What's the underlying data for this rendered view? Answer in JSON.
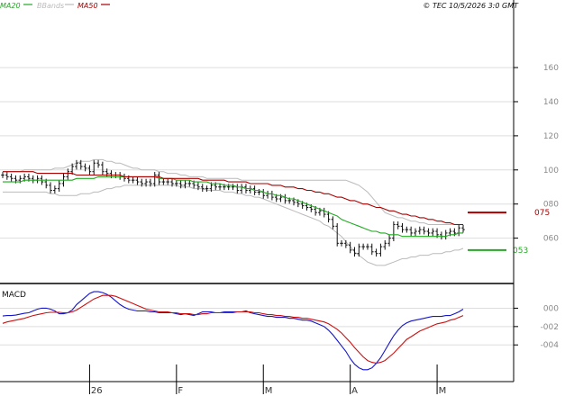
{
  "header": {
    "legend": [
      {
        "label": "MA20",
        "color": "#22aa22"
      },
      {
        "label": "BBands",
        "color": "#bbbbbb"
      },
      {
        "label": "MA50",
        "color": "#aa0000"
      }
    ],
    "copyright": "© TEC 10/5/2026 3:0 GMT"
  },
  "chart_data": [
    {
      "type": "candlestick",
      "panel": "price",
      "y_ticks": [
        "160",
        "140",
        "120",
        "100",
        "080",
        "060"
      ],
      "y_tick_values": [
        1.6,
        1.4,
        1.2,
        1.0,
        0.8,
        0.6
      ],
      "ylim": [
        0.35,
        1.88
      ],
      "x_ticks": [
        "26",
        "F",
        "M",
        "A",
        "M"
      ],
      "x_tick_index": [
        20,
        40,
        60,
        80,
        100
      ],
      "close": [
        0.97,
        0.96,
        0.95,
        0.94,
        0.95,
        0.96,
        0.95,
        0.94,
        0.95,
        0.93,
        0.91,
        0.88,
        0.89,
        0.92,
        0.96,
        0.99,
        1.02,
        1.04,
        1.02,
        1.01,
        0.99,
        1.04,
        1.03,
        0.99,
        0.98,
        0.97,
        0.97,
        0.96,
        0.95,
        0.94,
        0.94,
        0.93,
        0.92,
        0.93,
        0.92,
        0.97,
        0.93,
        0.93,
        0.93,
        0.92,
        0.92,
        0.91,
        0.92,
        0.92,
        0.91,
        0.9,
        0.89,
        0.89,
        0.91,
        0.9,
        0.9,
        0.9,
        0.9,
        0.9,
        0.88,
        0.9,
        0.88,
        0.89,
        0.87,
        0.87,
        0.85,
        0.86,
        0.84,
        0.83,
        0.84,
        0.82,
        0.82,
        0.81,
        0.8,
        0.79,
        0.78,
        0.77,
        0.75,
        0.76,
        0.74,
        0.71,
        0.67,
        0.57,
        0.57,
        0.56,
        0.53,
        0.51,
        0.55,
        0.55,
        0.55,
        0.52,
        0.51,
        0.55,
        0.57,
        0.6,
        0.68,
        0.67,
        0.65,
        0.65,
        0.63,
        0.64,
        0.65,
        0.64,
        0.63,
        0.64,
        0.62,
        0.61,
        0.63,
        0.64,
        0.63,
        0.66,
        0.65
      ],
      "overlays": [
        {
          "name": "MA20",
          "color": "#22aa22",
          "label": "053",
          "label_value": 0.53,
          "values": [
            0.93,
            0.93,
            0.93,
            0.93,
            0.93,
            0.94,
            0.94,
            0.94,
            0.94,
            0.94,
            0.94,
            0.94,
            0.94,
            0.94,
            0.94,
            0.94,
            0.94,
            0.95,
            0.95,
            0.95,
            0.95,
            0.95,
            0.96,
            0.96,
            0.96,
            0.96,
            0.96,
            0.96,
            0.96,
            0.96,
            0.96,
            0.96,
            0.96,
            0.96,
            0.96,
            0.96,
            0.95,
            0.95,
            0.95,
            0.95,
            0.94,
            0.94,
            0.94,
            0.94,
            0.93,
            0.93,
            0.93,
            0.93,
            0.92,
            0.92,
            0.92,
            0.91,
            0.91,
            0.91,
            0.9,
            0.9,
            0.89,
            0.89,
            0.88,
            0.88,
            0.87,
            0.86,
            0.86,
            0.85,
            0.85,
            0.84,
            0.83,
            0.83,
            0.82,
            0.81,
            0.8,
            0.79,
            0.78,
            0.77,
            0.76,
            0.75,
            0.74,
            0.73,
            0.71,
            0.7,
            0.69,
            0.68,
            0.67,
            0.66,
            0.65,
            0.64,
            0.64,
            0.63,
            0.63,
            0.62,
            0.62,
            0.62,
            0.61,
            0.61,
            0.61,
            0.61,
            0.61,
            0.61,
            0.61,
            0.61,
            0.61,
            0.61,
            0.61,
            0.62,
            0.62,
            0.63,
            0.63
          ]
        },
        {
          "name": "MA50",
          "color": "#aa0000",
          "label": "075",
          "label_value": 0.75,
          "values": [
            0.99,
            0.99,
            0.99,
            0.99,
            0.99,
            0.99,
            0.99,
            0.99,
            0.98,
            0.98,
            0.98,
            0.98,
            0.98,
            0.98,
            0.98,
            0.98,
            0.98,
            0.97,
            0.97,
            0.97,
            0.97,
            0.97,
            0.97,
            0.97,
            0.97,
            0.97,
            0.97,
            0.97,
            0.96,
            0.96,
            0.96,
            0.96,
            0.96,
            0.96,
            0.96,
            0.96,
            0.96,
            0.95,
            0.95,
            0.95,
            0.95,
            0.95,
            0.95,
            0.95,
            0.95,
            0.95,
            0.94,
            0.94,
            0.94,
            0.94,
            0.94,
            0.94,
            0.93,
            0.93,
            0.93,
            0.93,
            0.93,
            0.92,
            0.92,
            0.92,
            0.92,
            0.92,
            0.91,
            0.91,
            0.91,
            0.9,
            0.9,
            0.9,
            0.89,
            0.89,
            0.88,
            0.88,
            0.87,
            0.87,
            0.86,
            0.86,
            0.85,
            0.84,
            0.84,
            0.83,
            0.82,
            0.82,
            0.81,
            0.8,
            0.8,
            0.79,
            0.78,
            0.78,
            0.77,
            0.76,
            0.76,
            0.75,
            0.74,
            0.74,
            0.73,
            0.73,
            0.72,
            0.72,
            0.71,
            0.71,
            0.7,
            0.7,
            0.69,
            0.69,
            0.68,
            0.68,
            0.68
          ]
        },
        {
          "name": "BBands upper",
          "color": "#bbbbbb",
          "values": [
            0.99,
            0.99,
            0.99,
            0.99,
            0.99,
            1.0,
            1.0,
            1.0,
            1.0,
            1.0,
            1.0,
            1.0,
            1.01,
            1.01,
            1.01,
            1.02,
            1.03,
            1.04,
            1.05,
            1.05,
            1.05,
            1.06,
            1.06,
            1.06,
            1.05,
            1.05,
            1.04,
            1.04,
            1.03,
            1.02,
            1.01,
            1.01,
            1.0,
            1.0,
            1.0,
            1.0,
            0.99,
            0.99,
            0.98,
            0.98,
            0.98,
            0.97,
            0.97,
            0.96,
            0.96,
            0.96,
            0.96,
            0.95,
            0.95,
            0.95,
            0.95,
            0.95,
            0.95,
            0.95,
            0.95,
            0.94,
            0.94,
            0.94,
            0.94,
            0.94,
            0.94,
            0.94,
            0.94,
            0.94,
            0.94,
            0.94,
            0.94,
            0.94,
            0.94,
            0.94,
            0.94,
            0.94,
            0.94,
            0.94,
            0.94,
            0.94,
            0.94,
            0.94,
            0.94,
            0.94,
            0.93,
            0.92,
            0.91,
            0.89,
            0.87,
            0.84,
            0.81,
            0.78,
            0.75,
            0.74,
            0.73,
            0.72,
            0.72,
            0.71,
            0.7,
            0.7,
            0.69,
            0.69,
            0.68,
            0.68,
            0.68,
            0.68,
            0.68,
            0.68,
            0.68,
            0.68,
            0.68
          ]
        },
        {
          "name": "BBands lower",
          "color": "#bbbbbb",
          "values": [
            0.87,
            0.87,
            0.87,
            0.87,
            0.87,
            0.87,
            0.87,
            0.87,
            0.87,
            0.87,
            0.87,
            0.86,
            0.86,
            0.85,
            0.85,
            0.85,
            0.85,
            0.85,
            0.86,
            0.86,
            0.86,
            0.87,
            0.87,
            0.88,
            0.89,
            0.89,
            0.9,
            0.9,
            0.91,
            0.91,
            0.91,
            0.91,
            0.91,
            0.91,
            0.91,
            0.91,
            0.91,
            0.91,
            0.91,
            0.91,
            0.91,
            0.9,
            0.9,
            0.9,
            0.89,
            0.89,
            0.89,
            0.88,
            0.88,
            0.88,
            0.88,
            0.87,
            0.87,
            0.87,
            0.86,
            0.86,
            0.85,
            0.85,
            0.84,
            0.84,
            0.83,
            0.82,
            0.81,
            0.8,
            0.79,
            0.78,
            0.77,
            0.76,
            0.75,
            0.74,
            0.73,
            0.72,
            0.71,
            0.7,
            0.68,
            0.67,
            0.65,
            0.63,
            0.61,
            0.58,
            0.55,
            0.52,
            0.5,
            0.48,
            0.46,
            0.45,
            0.44,
            0.44,
            0.44,
            0.45,
            0.46,
            0.47,
            0.48,
            0.48,
            0.49,
            0.49,
            0.5,
            0.5,
            0.5,
            0.51,
            0.51,
            0.51,
            0.52,
            0.52,
            0.53,
            0.53,
            0.54
          ]
        }
      ]
    },
    {
      "type": "line",
      "panel": "macd",
      "title": "MACD",
      "y_ticks": [
        "000",
        "-002",
        "-004"
      ],
      "y_tick_values": [
        0.0,
        -0.02,
        -0.04
      ],
      "ylim": [
        -0.078,
        0.022
      ],
      "series": [
        {
          "name": "MACD",
          "color": "#1515c8",
          "values": [
            -0.0085,
            -0.008,
            -0.008,
            -0.0075,
            -0.0065,
            -0.0055,
            -0.005,
            -0.003,
            -0.001,
            0.0,
            0.0,
            -0.001,
            -0.003,
            -0.006,
            -0.006,
            -0.005,
            -0.002,
            0.004,
            0.008,
            0.012,
            0.016,
            0.018,
            0.018,
            0.017,
            0.015,
            0.012,
            0.008,
            0.004,
            0.001,
            -0.001,
            -0.002,
            -0.003,
            -0.003,
            -0.003,
            -0.004,
            -0.004,
            -0.005,
            -0.005,
            -0.005,
            -0.005,
            -0.006,
            -0.007,
            -0.006,
            -0.007,
            -0.008,
            -0.006,
            -0.004,
            -0.004,
            -0.004,
            -0.005,
            -0.005,
            -0.004,
            -0.004,
            -0.004,
            -0.004,
            -0.004,
            -0.003,
            -0.005,
            -0.006,
            -0.007,
            -0.008,
            -0.009,
            -0.009,
            -0.01,
            -0.01,
            -0.01,
            -0.011,
            -0.011,
            -0.012,
            -0.013,
            -0.013,
            -0.014,
            -0.016,
            -0.018,
            -0.02,
            -0.024,
            -0.029,
            -0.035,
            -0.041,
            -0.047,
            -0.055,
            -0.061,
            -0.065,
            -0.067,
            -0.067,
            -0.065,
            -0.06,
            -0.054,
            -0.046,
            -0.038,
            -0.03,
            -0.024,
            -0.019,
            -0.016,
            -0.014,
            -0.013,
            -0.012,
            -0.011,
            -0.01,
            -0.009,
            -0.009,
            -0.009,
            -0.008,
            -0.008,
            -0.006,
            -0.004,
            -0.001
          ]
        },
        {
          "name": "Signal",
          "color": "#cc1111",
          "values": [
            -0.0165,
            -0.015,
            -0.014,
            -0.013,
            -0.012,
            -0.011,
            -0.0095,
            -0.008,
            -0.007,
            -0.006,
            -0.005,
            -0.0045,
            -0.0045,
            -0.0045,
            -0.005,
            -0.005,
            -0.004,
            -0.002,
            0.001,
            0.004,
            0.007,
            0.01,
            0.012,
            0.014,
            0.014,
            0.014,
            0.013,
            0.011,
            0.009,
            0.007,
            0.005,
            0.003,
            0.001,
            -0.001,
            -0.002,
            -0.003,
            -0.004,
            -0.004,
            -0.004,
            -0.005,
            -0.005,
            -0.006,
            -0.006,
            -0.006,
            -0.007,
            -0.007,
            -0.006,
            -0.006,
            -0.005,
            -0.005,
            -0.005,
            -0.005,
            -0.005,
            -0.005,
            -0.004,
            -0.004,
            -0.004,
            -0.004,
            -0.005,
            -0.005,
            -0.006,
            -0.007,
            -0.007,
            -0.008,
            -0.008,
            -0.009,
            -0.009,
            -0.01,
            -0.01,
            -0.011,
            -0.011,
            -0.012,
            -0.013,
            -0.014,
            -0.015,
            -0.017,
            -0.02,
            -0.023,
            -0.027,
            -0.032,
            -0.037,
            -0.043,
            -0.048,
            -0.053,
            -0.057,
            -0.059,
            -0.06,
            -0.059,
            -0.057,
            -0.053,
            -0.049,
            -0.044,
            -0.039,
            -0.034,
            -0.031,
            -0.028,
            -0.025,
            -0.023,
            -0.021,
            -0.019,
            -0.017,
            -0.016,
            -0.015,
            -0.013,
            -0.012,
            -0.01,
            -0.008
          ]
        }
      ]
    }
  ]
}
